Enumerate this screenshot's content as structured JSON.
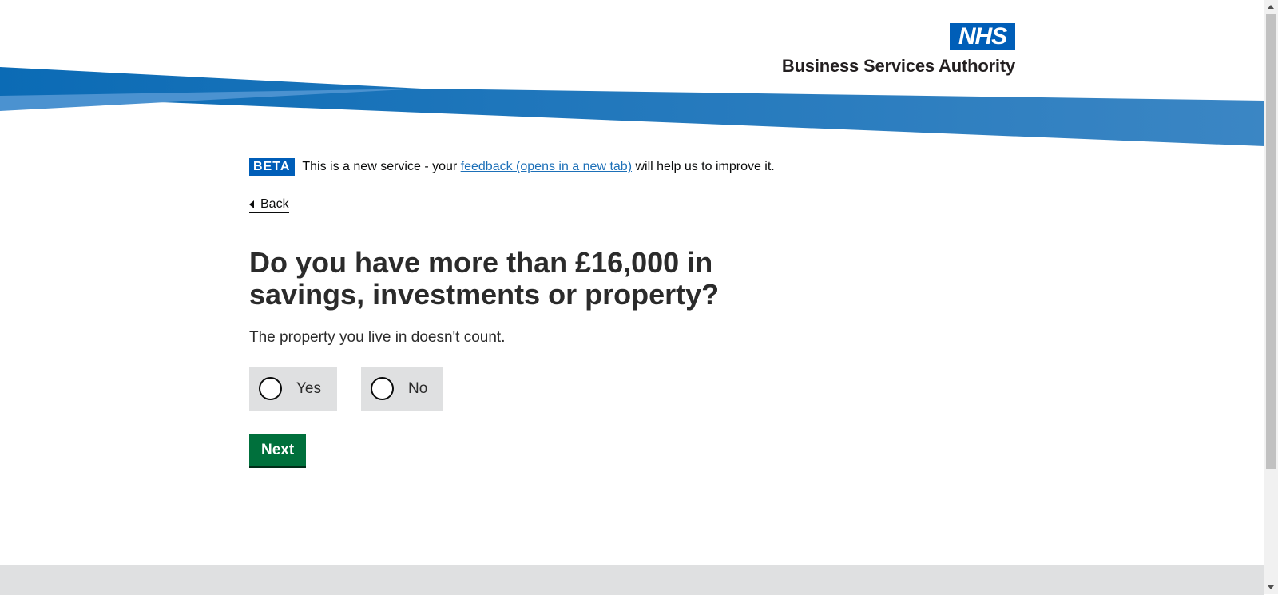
{
  "header": {
    "logo_nhs": "NHS",
    "logo_org": "Business Services Authority"
  },
  "phase_banner": {
    "tag": "BETA",
    "text_before": "This is a new service - your ",
    "link_text": "feedback (opens in a new tab)",
    "text_after": " will help us to improve it."
  },
  "back_link": "Back",
  "question": {
    "title": "Do you have more than £16,000 in savings, investments or property?",
    "hint": "The property you live in doesn't count.",
    "options": [
      {
        "label": "Yes",
        "selected": false
      },
      {
        "label": "No",
        "selected": false
      }
    ]
  },
  "next_button": "Next",
  "colors": {
    "nhs_blue": "#005eb8",
    "button_green": "#00703c",
    "link_blue": "#1d70b8"
  }
}
